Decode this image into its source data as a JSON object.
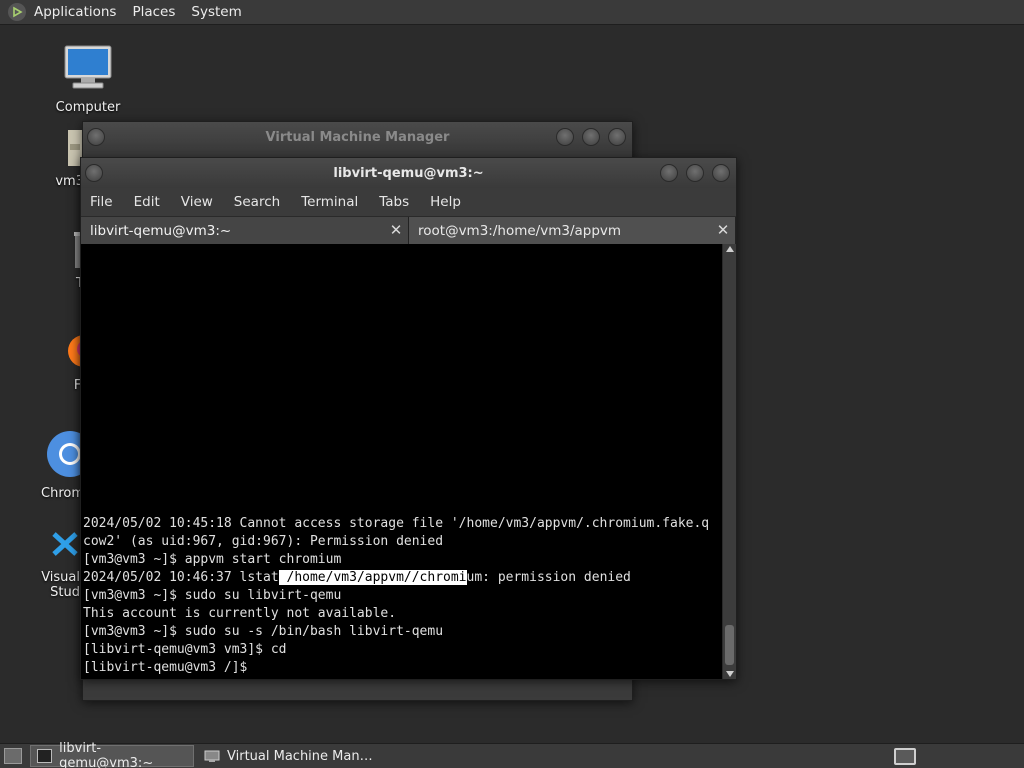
{
  "top_panel": {
    "menus": [
      "Applications",
      "Places",
      "System"
    ]
  },
  "desktop_icons": [
    {
      "name": "computer",
      "label": "Computer"
    },
    {
      "name": "home",
      "label": "vm3"
    },
    {
      "name": "trash",
      "label": "T"
    },
    {
      "name": "firefox",
      "label": "Fi"
    },
    {
      "name": "chromium",
      "label": "Chrom"
    },
    {
      "name": "vscode",
      "label": "Visual Stud"
    }
  ],
  "vmm_window": {
    "title": "Virtual Machine Manager"
  },
  "terminal": {
    "title": "libvirt-qemu@vm3:~",
    "menu": [
      "File",
      "Edit",
      "View",
      "Search",
      "Terminal",
      "Tabs",
      "Help"
    ],
    "tabs": [
      {
        "label": "libvirt-qemu@vm3:~",
        "active": true
      },
      {
        "label": "root@vm3:/home/vm3/appvm",
        "active": false
      }
    ],
    "lines": [
      "2024/05/02 10:45:18 Cannot access storage file '/home/vm3/appvm/.chromium.fake.q",
      "cow2' (as uid:967, gid:967): Permission denied",
      "[vm3@vm3 ~]$ appvm start chromium",
      "[vm3@vm3 ~]$ sudo su libvirt-qemu",
      "This account is currently not available.",
      "[vm3@vm3 ~]$ sudo su -s /bin/bash libvirt-qemu",
      "[libvirt-qemu@vm3 vm3]$ cd",
      "[libvirt-qemu@vm3 /]$"
    ],
    "lstat_line": {
      "prefix": "2024/05/02 10:46:37 lstat",
      "selected": " /home/vm3/appvm//chromi",
      "suffix": "um: permission denied"
    }
  },
  "taskbar": {
    "tasks": [
      {
        "label": "libvirt-qemu@vm3:~",
        "active": true
      },
      {
        "label": "Virtual Machine Man…",
        "active": false
      }
    ]
  },
  "colors": {
    "desktop_bg": "#2b2b2b",
    "panel_bg": "#3a3a3a",
    "terminal_bg": "#000000",
    "terminal_fg": "#e0e0e0",
    "selection_bg": "#ffffff",
    "selection_fg": "#000000"
  }
}
